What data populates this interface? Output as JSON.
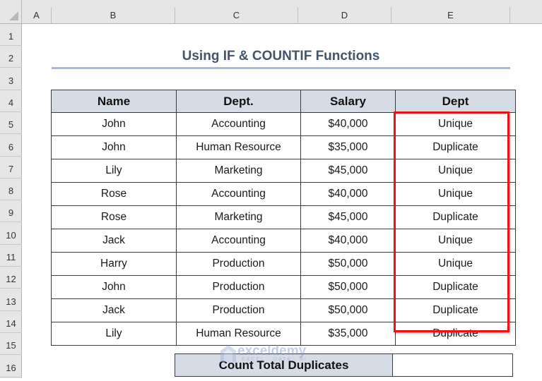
{
  "columns": [
    "A",
    "B",
    "C",
    "D",
    "E"
  ],
  "rows": [
    "1",
    "2",
    "3",
    "4",
    "5",
    "6",
    "7",
    "8",
    "9",
    "10",
    "11",
    "12",
    "13",
    "14",
    "15",
    "16"
  ],
  "title": "Using IF & COUNTIF Functions",
  "table": {
    "headers": [
      "Name",
      "Dept.",
      "Salary",
      "Dept"
    ],
    "rows": [
      [
        "John",
        "Accounting",
        "$40,000",
        "Unique"
      ],
      [
        "John",
        "Human Resource",
        "$35,000",
        "Duplicate"
      ],
      [
        "Lily",
        "Marketing",
        "$45,000",
        "Unique"
      ],
      [
        "Rose",
        "Accounting",
        "$40,000",
        "Unique"
      ],
      [
        "Rose",
        "Marketing",
        "$45,000",
        "Duplicate"
      ],
      [
        "Jack",
        "Accounting",
        "$40,000",
        "Unique"
      ],
      [
        "Harry",
        "Production",
        "$50,000",
        "Unique"
      ],
      [
        "John",
        "Production",
        "$50,000",
        "Duplicate"
      ],
      [
        "Jack",
        "Production",
        "$50,000",
        "Duplicate"
      ],
      [
        "Lily",
        "Human Resource",
        "$35,000",
        "Duplicate"
      ]
    ]
  },
  "summary": {
    "label": "Count Total Duplicates",
    "value": ""
  },
  "highlight_color": "#ee1111",
  "header_fill": "#d6dce5",
  "watermark": {
    "text": "exceldemy",
    "sub": "EXCEL · DATA · BI"
  }
}
